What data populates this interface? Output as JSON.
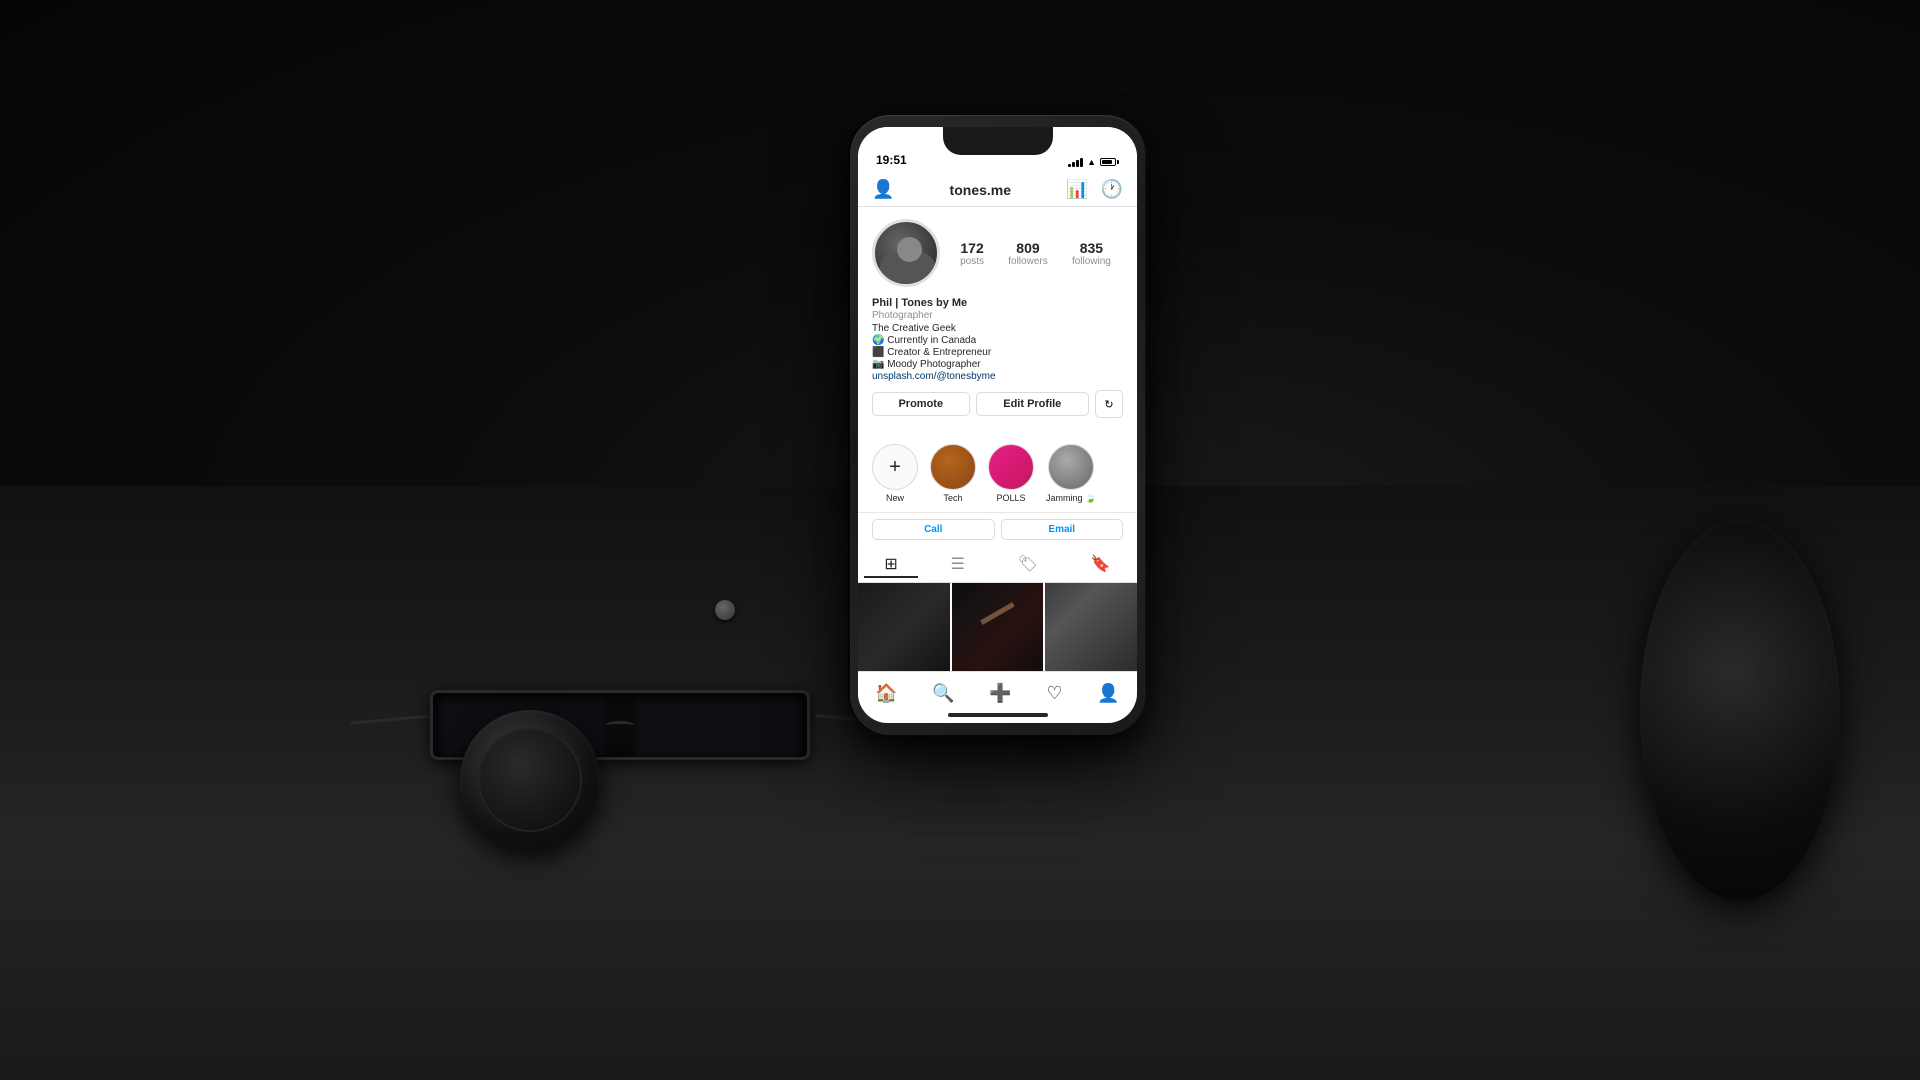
{
  "scene": {
    "background_color": "#0a0a0a"
  },
  "phone": {
    "status_bar": {
      "time": "19:51"
    },
    "app": {
      "header": {
        "username": "tones.me",
        "add_icon": "person-icon",
        "chart_icon": "bar-chart-icon",
        "history_icon": "history-icon"
      },
      "profile": {
        "stats": {
          "posts": {
            "count": "172",
            "label": "posts"
          },
          "followers": {
            "count": "809",
            "label": "followers"
          },
          "following": {
            "count": "835",
            "label": "following"
          }
        },
        "buttons": {
          "promote": "Promote",
          "edit_profile": "Edit Profile"
        },
        "bio": {
          "name": "Phil | Tones by Me",
          "role": "Photographer",
          "line1": "The Creative Geek",
          "line2": "🌍 Currently in Canada",
          "line3": "⬛ Creator & Entrepreneur",
          "line4": "📷 Moody Photographer",
          "link": "unsplash.com/@tonesbyme"
        },
        "highlights": [
          {
            "label": "New",
            "type": "new"
          },
          {
            "label": "Tech",
            "type": "tech"
          },
          {
            "label": "POLLS",
            "type": "polls"
          },
          {
            "label": "Jamming 🍃",
            "type": "jamming"
          }
        ],
        "contact_buttons": {
          "call": "Call",
          "email": "Email"
        }
      },
      "nav": {
        "items": [
          "home",
          "search",
          "add",
          "heart",
          "profile"
        ]
      }
    }
  }
}
